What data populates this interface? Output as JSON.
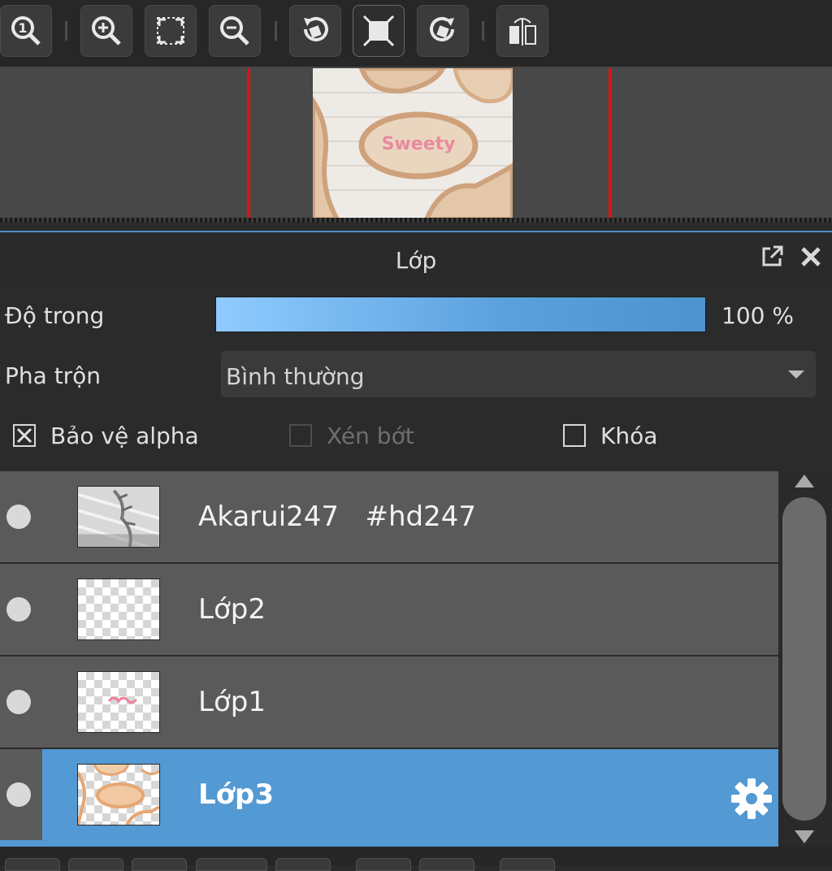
{
  "toolbar": {
    "buttons": [
      {
        "name": "zoom-actual-size-icon",
        "active": false
      },
      {
        "name": "zoom-in-icon",
        "active": false
      },
      {
        "name": "fit-screen-icon",
        "active": false
      },
      {
        "name": "zoom-out-icon",
        "active": false
      },
      {
        "name": "rotate-left-icon",
        "active": false
      },
      {
        "name": "fit-canvas-icon",
        "active": true
      },
      {
        "name": "rotate-right-icon",
        "active": false
      },
      {
        "name": "flip-horizontal-icon",
        "active": false
      }
    ]
  },
  "panel": {
    "title": "Lớp",
    "detach_icon": "popout-icon",
    "close_icon": "close-icon"
  },
  "opacity": {
    "label": "Độ trong",
    "value": 100,
    "value_text": "100 %"
  },
  "blend": {
    "label": "Pha trộn",
    "value": "Bình thường"
  },
  "options": [
    {
      "label": "Bảo vệ alpha",
      "checked": true,
      "enabled": true
    },
    {
      "label": "Xén bớt",
      "checked": false,
      "enabled": false
    },
    {
      "label": "Khóa",
      "checked": false,
      "enabled": true
    }
  ],
  "layers": [
    {
      "name": "Akarui247   #hd247",
      "visible": true,
      "selected": false
    },
    {
      "name": "Lớp2",
      "visible": true,
      "selected": false
    },
    {
      "name": "Lớp1",
      "visible": true,
      "selected": false
    },
    {
      "name": "Lớp3",
      "visible": true,
      "selected": true
    }
  ],
  "colors": {
    "accent": "#5399d3",
    "marker_red": "#e01212"
  }
}
